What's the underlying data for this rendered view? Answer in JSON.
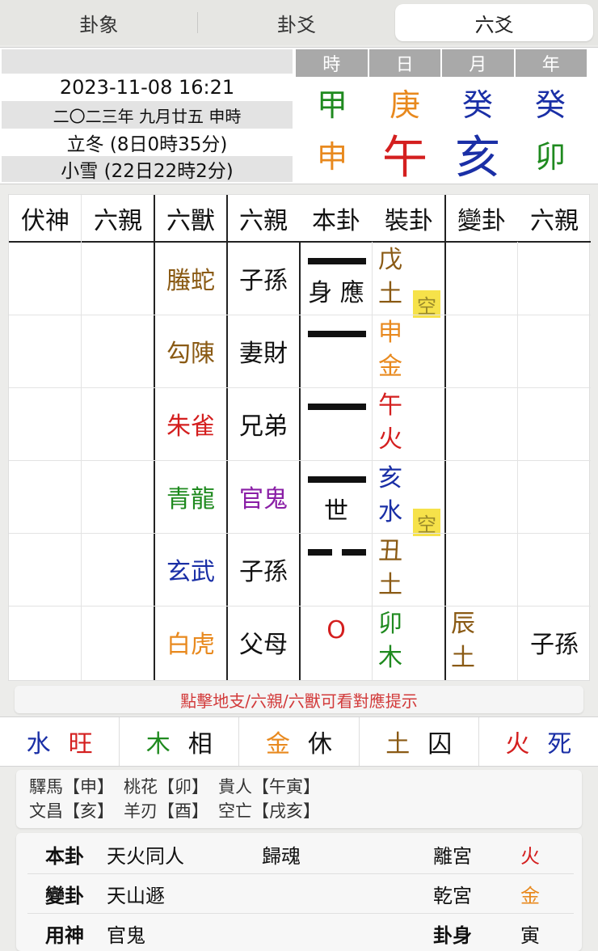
{
  "tabs": [
    {
      "label": "卦象",
      "active": false
    },
    {
      "label": "卦爻",
      "active": false
    },
    {
      "label": "六爻",
      "active": true
    }
  ],
  "date": {
    "gregorian": "2023-11-08 16:21",
    "lunar": "二〇二三年 九月廿五 申時",
    "term1": "立冬 (8日0時35分)",
    "term2": "小雪 (22日22時2分)"
  },
  "pillars": {
    "labels": [
      "時",
      "日",
      "月",
      "年"
    ],
    "stems": [
      {
        "char": "甲",
        "color": "#1f8a1f"
      },
      {
        "char": "庚",
        "color": "#e8891e"
      },
      {
        "char": "癸",
        "color": "#1a2fa6"
      },
      {
        "char": "癸",
        "color": "#1a2fa6"
      }
    ],
    "branches": [
      {
        "char": "申",
        "color": "#e8891e"
      },
      {
        "char": "午",
        "color": "#d41f1f"
      },
      {
        "char": "亥",
        "color": "#1a2fa6"
      },
      {
        "char": "卯",
        "color": "#1f8a1f"
      }
    ]
  },
  "grid": {
    "headers": [
      "伏神",
      "六親",
      "六獸",
      "六親",
      "本卦",
      "裝卦",
      "變卦",
      "六親"
    ],
    "rows": [
      {
        "beast": "螣蛇",
        "beastColor": "#8a5a14",
        "relative": "子孫",
        "relColor": "#111",
        "yao": "yang",
        "mark": "身 應",
        "gan1": "戊",
        "gan2": "土",
        "ganColor": "#8a5a14",
        "kong": "空",
        "chg1": "",
        "chg2": "",
        "chgColor": "#8a5a14",
        "chgRel": ""
      },
      {
        "beast": "勾陳",
        "beastColor": "#8a5a14",
        "relative": "妻財",
        "relColor": "#111",
        "yao": "yang",
        "mark": "",
        "gan1": "申",
        "gan2": "金",
        "ganColor": "#e8891e",
        "kong": "",
        "chg1": "",
        "chg2": "",
        "chgColor": "#8a5a14",
        "chgRel": ""
      },
      {
        "beast": "朱雀",
        "beastColor": "#d41f1f",
        "relative": "兄弟",
        "relColor": "#111",
        "yao": "yang",
        "mark": "",
        "gan1": "午",
        "gan2": "火",
        "ganColor": "#d41f1f",
        "kong": "",
        "chg1": "",
        "chg2": "",
        "chgColor": "#8a5a14",
        "chgRel": ""
      },
      {
        "beast": "青龍",
        "beastColor": "#1f8a1f",
        "relative": "官鬼",
        "relColor": "#8a1fa6",
        "yao": "yang",
        "mark": "世",
        "gan1": "亥",
        "gan2": "水",
        "ganColor": "#1a2fa6",
        "kong": "空",
        "chg1": "",
        "chg2": "",
        "chgColor": "#8a5a14",
        "chgRel": ""
      },
      {
        "beast": "玄武",
        "beastColor": "#1a2fa6",
        "relative": "子孫",
        "relColor": "#111",
        "yao": "yin",
        "mark": "",
        "gan1": "丑",
        "gan2": "土",
        "ganColor": "#8a5a14",
        "kong": "",
        "chg1": "",
        "chg2": "",
        "chgColor": "#8a5a14",
        "chgRel": ""
      },
      {
        "beast": "白虎",
        "beastColor": "#e8891e",
        "relative": "父母",
        "relColor": "#111",
        "yao": "moving",
        "mark": "O",
        "gan1": "卯",
        "gan2": "木",
        "ganColor": "#1f8a1f",
        "kong": "",
        "chg1": "辰",
        "chg2": "土",
        "chgColor": "#8a5a14",
        "chgRel": "子孫"
      }
    ]
  },
  "hint": "點擊地支/六親/六獸可看對應提示",
  "wuxing": [
    {
      "el": "水",
      "elColor": "#1a2fa6",
      "state": "旺",
      "stateColor": "#d41f1f"
    },
    {
      "el": "木",
      "elColor": "#1f8a1f",
      "state": "相",
      "stateColor": "#111"
    },
    {
      "el": "金",
      "elColor": "#e8891e",
      "state": "休",
      "stateColor": "#111"
    },
    {
      "el": "土",
      "elColor": "#8a5a14",
      "state": "囚",
      "stateColor": "#111"
    },
    {
      "el": "火",
      "elColor": "#d41f1f",
      "state": "死",
      "stateColor": "#1a2fa6"
    }
  ],
  "stars": {
    "line1": [
      "驛馬【申】",
      "桃花【卯】",
      "貴人【午寅】"
    ],
    "line2": [
      "文昌【亥】",
      "羊刃【酉】",
      "空亡【戌亥】"
    ]
  },
  "info": {
    "ben_label": "本卦",
    "ben_name": "天火同人",
    "ben_type": "歸魂",
    "ben_palace": "離宮",
    "ben_el": "火",
    "ben_el_color": "#d41f1f",
    "bian_label": "變卦",
    "bian_name": "天山遯",
    "bian_palace": "乾宮",
    "bian_el": "金",
    "bian_el_color": "#e8891e",
    "yong_label": "用神",
    "yong_value": "官鬼",
    "shen_label": "卦身",
    "shen_value": "寅"
  }
}
